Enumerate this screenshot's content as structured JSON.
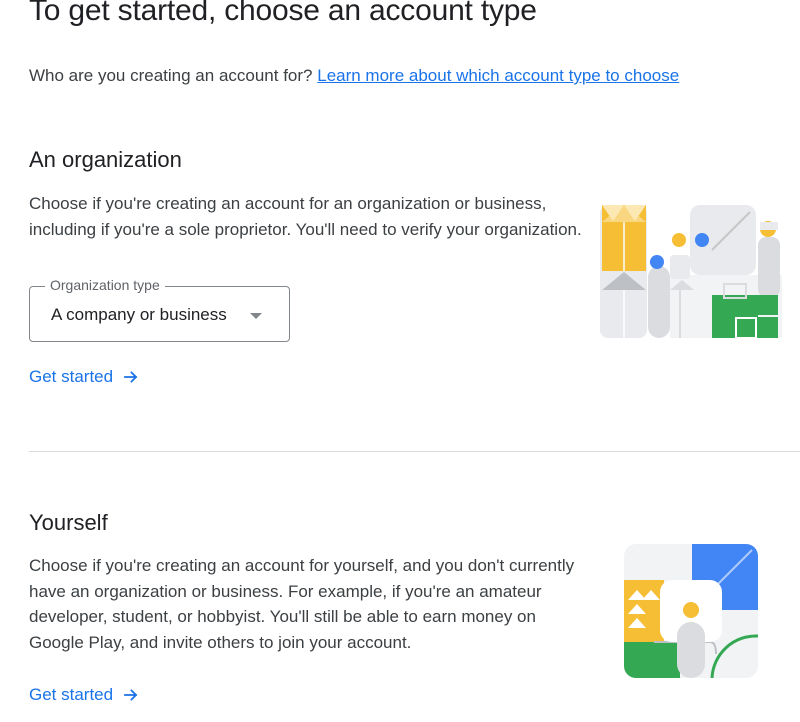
{
  "page": {
    "title": "To get started, choose an account type",
    "intro_text": "Who are you creating an account for?",
    "intro_link": "Learn more about which account type to choose"
  },
  "organization": {
    "title": "An organization",
    "description": "Choose if you're creating an account for an organization or business, including if you're a sole proprietor. You'll need to verify your organization.",
    "org_type_label": "Organization type",
    "org_type_value": "A company or business",
    "action_label": "Get started"
  },
  "yourself": {
    "title": "Yourself",
    "description": "Choose if you're creating an account for yourself, and you don't currently have an organization or business. For example, if you're an amateur developer, student, or hobbyist. You'll still be able to earn money on Google Play, and invite others to join your account.",
    "action_label": "Get started"
  },
  "colors": {
    "link": "#1a73e8",
    "yellow": "#f6be35",
    "blue": "#4285f4",
    "green": "#34a853",
    "gray": "#dadce0"
  },
  "icons": {
    "org_type_dropdown": "chevron-down-icon",
    "action_arrow": "arrow-right-icon"
  }
}
